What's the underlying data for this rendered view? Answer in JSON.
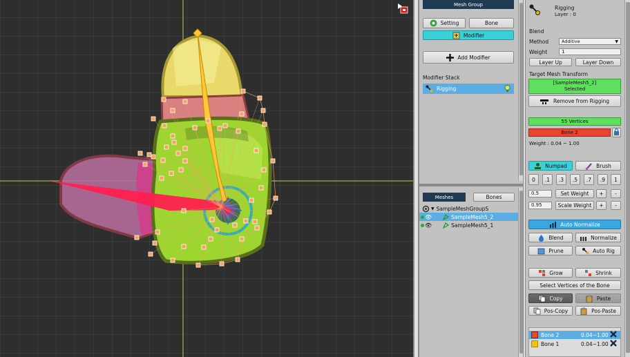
{
  "viewport": {
    "background": "#2e2e2e",
    "mesh_vertex_color": "#f7a15f",
    "bone_color": "#ff2050",
    "selected_bone_color": "#ffc83a",
    "crosshair_color": "#cfcf4a"
  },
  "mesh_group_panel": {
    "header": "Mesh Group",
    "setting_label": "Setting",
    "bone_label": "Bone",
    "modifier_label": "Modifier",
    "add_modifier_label": "Add Modifier",
    "modifier_stack_label": "Modifier Stack",
    "modifiers": [
      {
        "label": "Rigging",
        "selected": true
      }
    ]
  },
  "hierarchy_panel": {
    "tab_meshes": "Meshes",
    "tab_bones": "Bones",
    "root": "SampleMeshGroupS",
    "items": [
      {
        "label": "SampleMesh5_2",
        "selected": true
      },
      {
        "label": "SampleMesh5_1",
        "selected": false
      }
    ]
  },
  "inspector": {
    "modifier_name": "Rigging",
    "layer_text": "Layer : 0",
    "blend_label": "Blend",
    "method_label": "Method",
    "method_value": "Additive",
    "weight_label": "Weight",
    "weight_value": "1",
    "layer_up_label": "Layer Up",
    "layer_down_label": "Layer Down",
    "target_mesh_label": "Target Mesh Transform",
    "selected_mesh_line1": "[SampleMesh5_2]",
    "selected_mesh_line2": "Selected",
    "remove_rigging_label": "Remove from Rigging",
    "vertices_label": "55 Vertices",
    "bone_selected_label": "Bone 2",
    "weight_range_label": "Weight : 0.04 ~ 1.00",
    "numpad_label": "Numpad",
    "brush_label": "Brush",
    "numpad_values": [
      "0",
      ".1",
      ".3",
      ".5",
      ".7",
      ".9",
      "1"
    ],
    "set_weight_value": "0.5",
    "set_weight_label": "Set Weight",
    "scale_weight_value": "0.95",
    "scale_weight_label": "Scale Weight",
    "plus_label": "+",
    "minus_label": "-",
    "auto_normalize_label": "Auto Normalize",
    "blend_button_label": "Blend",
    "normalize_label": "Normalize",
    "prune_label": "Prune",
    "auto_rig_label": "Auto Rig",
    "grow_label": "Grow",
    "shrink_label": "Shrink",
    "select_vertices_label": "Select Vertices of the Bone",
    "copy_label": "Copy",
    "paste_label": "Paste",
    "pos_copy_label": "Pos-Copy",
    "pos_paste_label": "Pos-Paste",
    "bone_weights": [
      {
        "name": "Bone 2",
        "range": "0.04~1.00",
        "color": "#e84a2a",
        "selected": true
      },
      {
        "name": "Bone 1",
        "range": "0.04~1.00",
        "color": "#f2c418",
        "selected": false
      }
    ]
  },
  "colors": {
    "green_status": "#5ee05e",
    "red_status": "#e8432f",
    "cyan_toggle": "#3ad0d8",
    "selection_blue": "#5aaee3",
    "header_navy": "#1f3a52"
  }
}
